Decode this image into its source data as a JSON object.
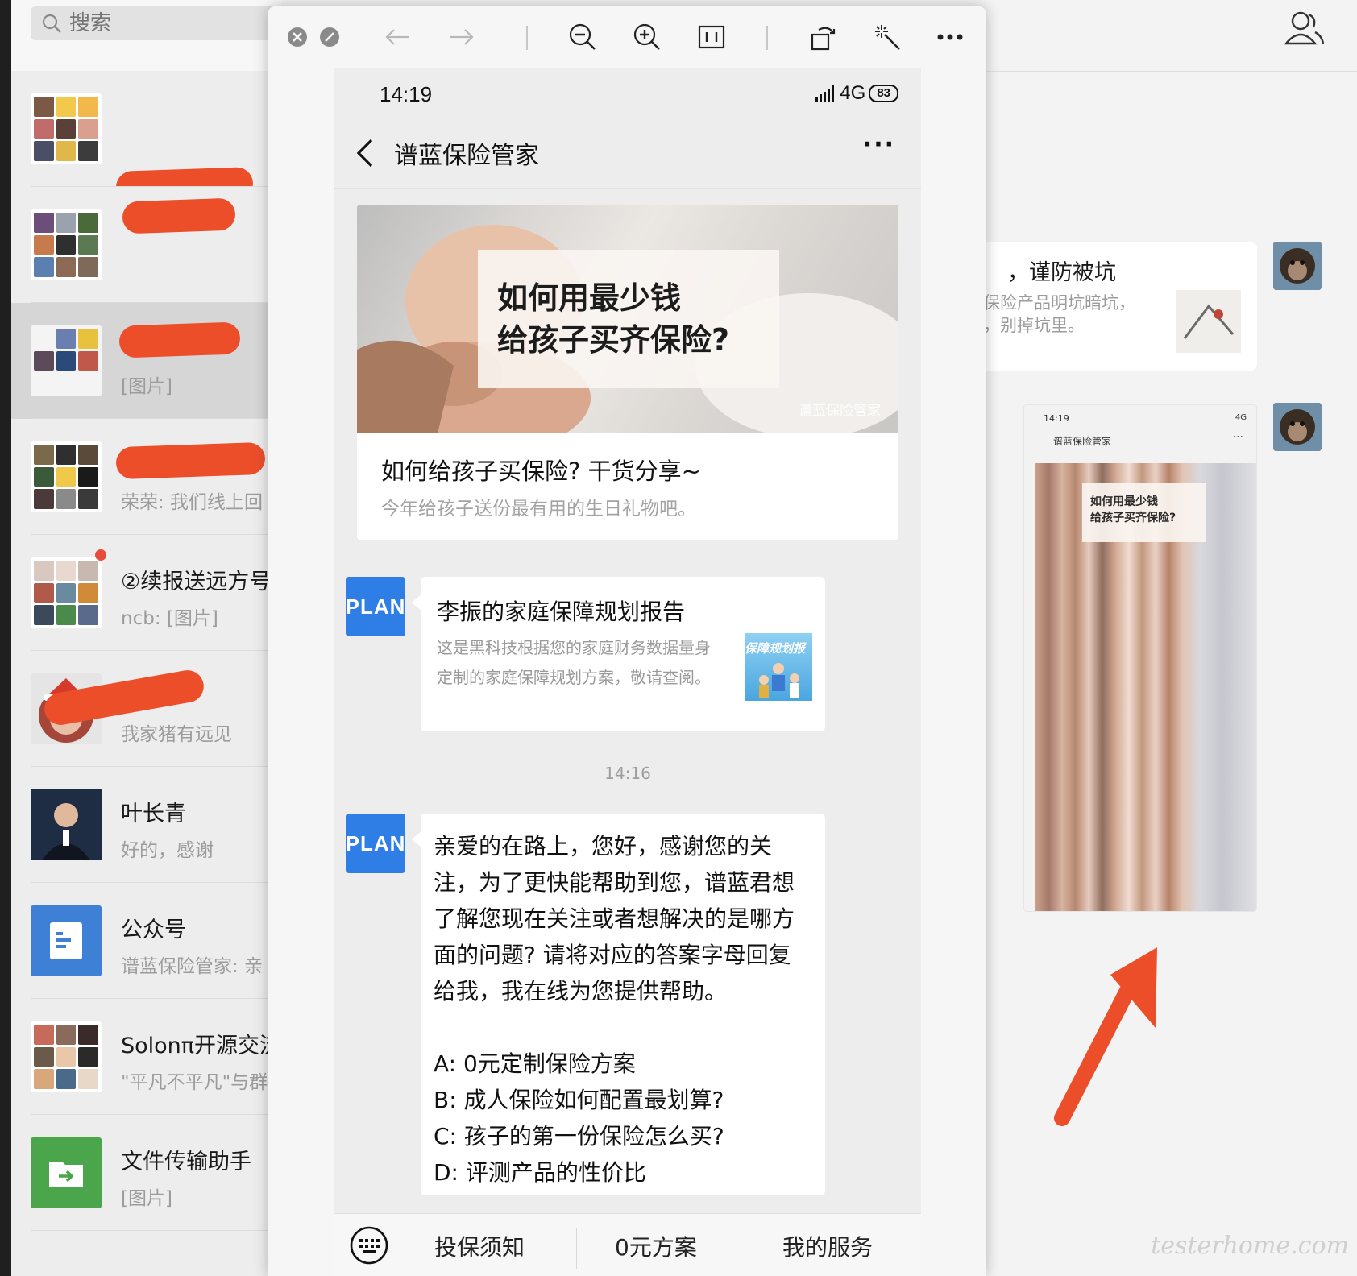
{
  "search": {
    "placeholder": "搜索"
  },
  "chat_list": [
    {
      "name": "",
      "preview": ""
    },
    {
      "name": "",
      "preview": ""
    },
    {
      "name": "",
      "preview": "[图片]"
    },
    {
      "name": "",
      "preview": "荣荣: 我们线上回"
    },
    {
      "name": "②续报送远方号",
      "preview": "ncb: [图片]"
    },
    {
      "name": "",
      "preview": "我家猪有远见"
    },
    {
      "name": "叶长青",
      "preview": "好的，感谢"
    },
    {
      "name": "公众号",
      "preview": "谱蓝保险管家: 亲"
    },
    {
      "name": "Solonπ开源交流",
      "preview": "\"平凡不平凡\"与群"
    },
    {
      "name": "文件传输助手",
      "preview": "[图片]"
    }
  ],
  "bg_chat": {
    "bubble_title": "，谨防被坑",
    "bubble_line1": "保险产品明坑暗坑，",
    "bubble_line2": "，别掉坑里。",
    "thumb_time": "14:19",
    "thumb_signal": "4G",
    "thumb_nav_title": "谱蓝保险管家",
    "thumb_card_text_1": "如何用最少钱",
    "thumb_card_text_2": "给孩子买齐保险?"
  },
  "phone": {
    "status_time": "14:19",
    "status_network": "4G",
    "battery": "83",
    "nav_title": "谱蓝保险管家",
    "nav_more": "···",
    "article": {
      "image_line1": "如何用最少钱",
      "image_line2": "给孩子买齐保险?",
      "image_watermark": "谱蓝保险管家",
      "title": "如何给孩子买保险? 干货分享~",
      "desc": "今年给孩子送份最有用的生日礼物吧。"
    },
    "avatar_label": "PLAN",
    "link_card": {
      "title": "李振的家庭保障规划报告",
      "desc": "这是黑科技根据您的家庭财务数据量身定制的家庭保障规划方案，敬请查阅。",
      "thumb_text": "保障规划报"
    },
    "timestamp": "14:16",
    "text_message": {
      "body": "亲爱的在路上，您好，感谢您的关注，为了更快能帮助到您，谱蓝君想了解您现在关注或者想解决的是哪方面的问题? 请将对应的答案字母回复给我，我在线为您提供帮助。",
      "options": [
        "A:  0元定制保险方案",
        "B:  成人保险如何配置最划算?",
        "C:  孩子的第一份保险怎么买?",
        "D: 评测产品的性价比"
      ]
    },
    "menu": [
      "投保须知",
      "0元方案",
      "我的服务"
    ]
  },
  "watermark": "testerhome.com",
  "colors": {
    "redact": "#ed4e2a",
    "accent_blue": "#2f7ee6",
    "arrow": "#ed4e2a"
  }
}
